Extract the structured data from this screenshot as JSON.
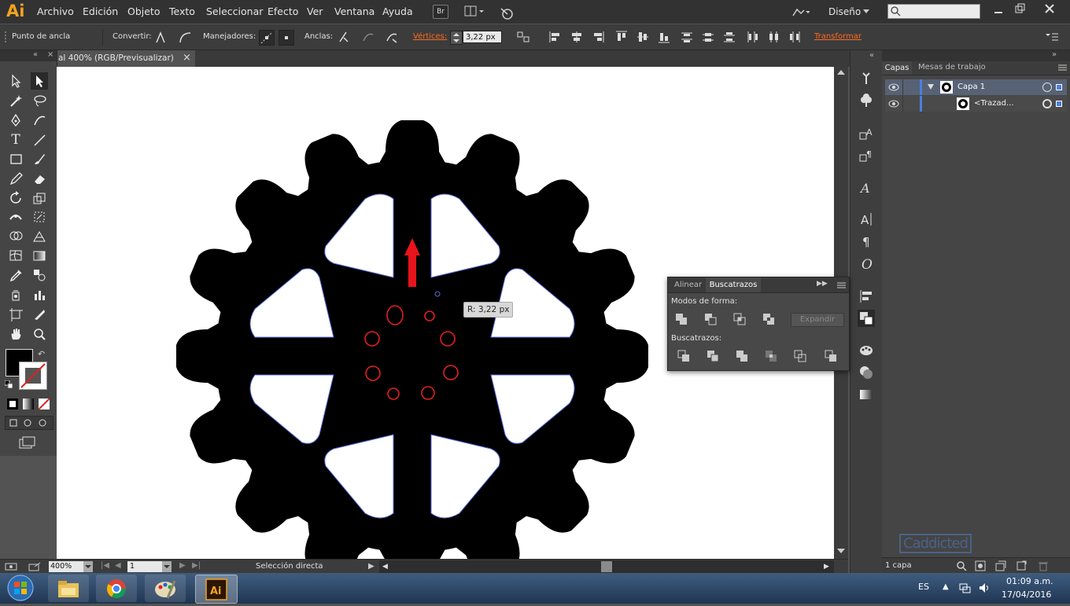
{
  "app": {
    "logo": "Ai"
  },
  "menu": [
    "Archivo",
    "Edición",
    "Objeto",
    "Texto",
    "Seleccionar",
    "Efecto",
    "Ver",
    "Ventana",
    "Ayuda"
  ],
  "bridge_label": "Br",
  "workspace": "Diseño",
  "search_placeholder": "",
  "control_bar": {
    "mode_label": "Punto de ancla",
    "convertir_label": "Convertir:",
    "manejadores_label": "Manejadores:",
    "anclas_label": "Anclas:",
    "vertices_label": "Vértices:",
    "vertices_value": "3,22 px",
    "transformar_label": "Transformar"
  },
  "document_tab": {
    "title": "al 400% (RGB/Previsualizar)",
    "close": "×"
  },
  "canvas": {
    "tooltip": "R: 3,22 px"
  },
  "status_bar": {
    "zoom": "400%",
    "artboard": "1",
    "tool_name": "Selección directa"
  },
  "layers_panel": {
    "tabs": [
      "Capas",
      "Mesas de trabajo"
    ],
    "rows": [
      {
        "name": "Capa 1"
      },
      {
        "name": "<Trazad..."
      }
    ],
    "footer": "1 capa"
  },
  "pathfinder_panel": {
    "tabs": [
      "Alinear",
      "Buscatrazos"
    ],
    "shape_modes_label": "Modos de forma:",
    "expand_label": "Expandir",
    "pathfinders_label": "Buscatrazos:"
  },
  "watermark": "Caddicted",
  "taskbar": {
    "language": "ES",
    "time": "01:09 a.m.",
    "date": "17/04/2016",
    "apps": [
      "file-explorer",
      "chrome",
      "paint",
      "illustrator"
    ]
  },
  "colors": {
    "accent": "#f4a21f",
    "highlight": "#ff5722",
    "selection": "#e02020"
  }
}
